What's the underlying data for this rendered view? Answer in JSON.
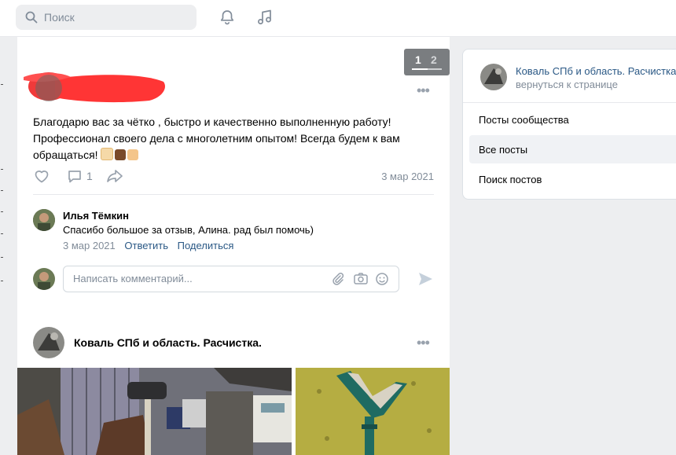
{
  "topbar": {
    "search_placeholder": "Поиск",
    "icons": [
      "search-icon",
      "bell-icon",
      "music-icon"
    ]
  },
  "pager": {
    "page1": "1",
    "page2": "2"
  },
  "post": {
    "text_line1": "Благодарю вас за чётко , быстро и качественно выполненную работу!",
    "text_line2": "Профессионал своего дела с многолетним опытом! Всегда будем к вам",
    "text_line3": "обращаться!",
    "emojis": [
      "raised-hands-emoji",
      "ox-emoji",
      "thumbs-up-emoji"
    ],
    "comment_count": "1",
    "date": "3 мар 2021"
  },
  "comment": {
    "author": "Илья Тёмкин",
    "text": "Спасибо большое за отзыв, Алина. рад был помочь)",
    "date": "3 мар 2021",
    "reply_label": "Ответить",
    "share_label": "Поделиться"
  },
  "comment_input": {
    "placeholder": "Написать комментарий..."
  },
  "post2": {
    "author": "Коваль СПб и область. Расчистка."
  },
  "sidebar": {
    "group_name": "Коваль СПб и область. Расчистка.",
    "back_label": "вернуться к странице",
    "items": [
      {
        "label": "Посты сообщества",
        "active": false
      },
      {
        "label": "Все посты",
        "active": true
      },
      {
        "label": "Поиск постов",
        "active": false
      }
    ]
  },
  "colors": {
    "accent_link": "#2a5885",
    "muted": "#818c99",
    "background": "#edeef0"
  }
}
